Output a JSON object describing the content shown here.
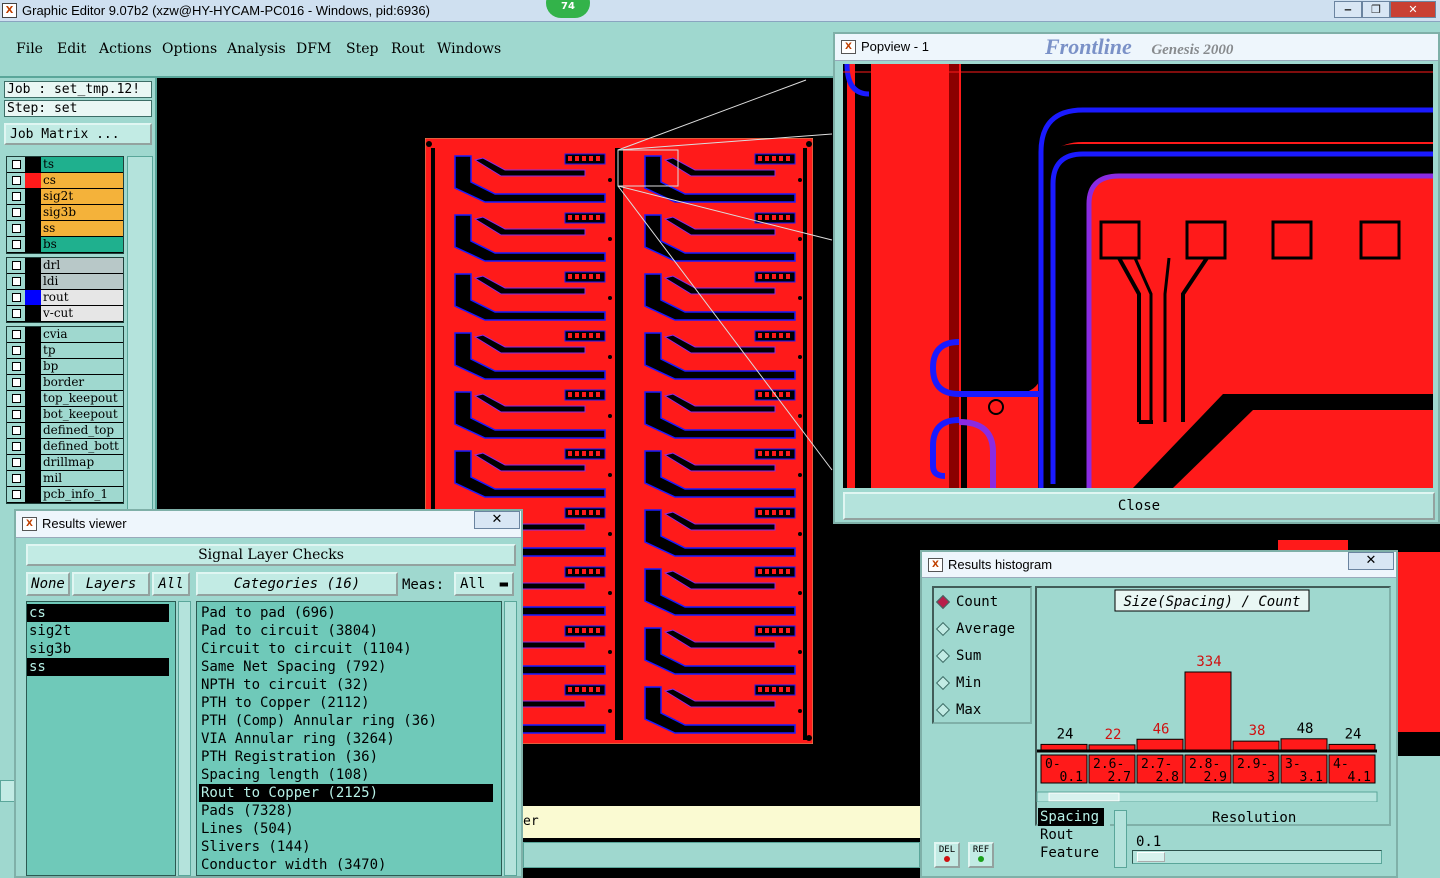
{
  "window": {
    "title": "Graphic Editor 9.07b2 (xzw@HY-HYCAM-PC016 - Windows, pid:6936)",
    "taskbar_badge": "74",
    "min_label": "‒",
    "max_label": "❐",
    "close_label": "✕"
  },
  "menu": [
    "File",
    "Edit",
    "Actions",
    "Options",
    "Analysis",
    "DFM",
    "Step",
    "Rout",
    "Windows"
  ],
  "info": {
    "job": "Job : set_tmp.12!",
    "step": "Step: set",
    "job_matrix": "Job Matrix ..."
  },
  "layer_groups": [
    [
      {
        "name": "ts",
        "color": "#1fb08e"
      },
      {
        "name": "cs",
        "color": "#f4b23a",
        "swatch": "#ff1a1a"
      },
      {
        "name": "sig2t",
        "color": "#f4b23a"
      },
      {
        "name": "sig3b",
        "color": "#f4b23a"
      },
      {
        "name": "ss",
        "color": "#f4b23a"
      },
      {
        "name": "bs",
        "color": "#1fb08e"
      }
    ],
    [
      {
        "name": "drl",
        "color": "#b8c8c8"
      },
      {
        "name": "ldi",
        "color": "#b8c8c8"
      },
      {
        "name": "rout",
        "color": "#e6e6e6",
        "swatch": "#0000ff"
      },
      {
        "name": "v-cut",
        "color": "#e6e6e6"
      }
    ],
    [
      {
        "name": "cvia",
        "color": "#9fd8cf"
      },
      {
        "name": "tp",
        "color": "#9fd8cf"
      },
      {
        "name": "bp",
        "color": "#9fd8cf"
      },
      {
        "name": "border",
        "color": "#9fd8cf"
      },
      {
        "name": "top_keepout",
        "color": "#9fd8cf"
      },
      {
        "name": "bot_keepout",
        "color": "#9fd8cf"
      },
      {
        "name": "defined_top",
        "color": "#9fd8cf"
      },
      {
        "name": "defined_bott",
        "color": "#9fd8cf"
      },
      {
        "name": "drillmap",
        "color": "#9fd8cf"
      },
      {
        "name": "mil",
        "color": "#9fd8cf"
      },
      {
        "name": "pcb_info_1",
        "color": "#9fd8cf"
      }
    ]
  ],
  "popview": {
    "title": "Popview - 1",
    "banner_brand": "Frontline",
    "banner_product": "Genesis 2000",
    "close": "Close"
  },
  "results_viewer": {
    "title": "Results viewer",
    "heading": "Signal Layer Checks",
    "none_btn": "None",
    "layers_btn": "Layers",
    "all_btn": "All",
    "categories_btn": "Categories (16)",
    "meas_label": "Meas:",
    "meas_value": "All",
    "layers": [
      {
        "name": "cs",
        "selected": true
      },
      {
        "name": "sig2t",
        "selected": false
      },
      {
        "name": "sig3b",
        "selected": false
      },
      {
        "name": "ss",
        "selected": true
      }
    ],
    "categories": [
      {
        "label": "Pad to pad (696)",
        "selected": false
      },
      {
        "label": "Pad to circuit (3804)",
        "selected": false
      },
      {
        "label": "Circuit to circuit (1104)",
        "selected": false
      },
      {
        "label": "Same Net Spacing (792)",
        "selected": false
      },
      {
        "label": "NPTH to circuit (32)",
        "selected": false
      },
      {
        "label": "PTH to Copper (2112)",
        "selected": false
      },
      {
        "label": "PTH (Comp) Annular ring (36)",
        "selected": false
      },
      {
        "label": "VIA Annular ring (3264)",
        "selected": false
      },
      {
        "label": "PTH Registration (36)",
        "selected": false
      },
      {
        "label": "Spacing length (108)",
        "selected": false
      },
      {
        "label": "Rout to Copper (2125)",
        "selected": true
      },
      {
        "label": "Pads (7328)",
        "selected": false
      },
      {
        "label": "Lines (504)",
        "selected": false
      },
      {
        "label": "Slivers (144)",
        "selected": false
      },
      {
        "label": "Conductor width (3470)",
        "selected": false
      }
    ]
  },
  "histogram": {
    "title": "Results histogram",
    "modes": [
      {
        "label": "Count",
        "on": true
      },
      {
        "label": "Average",
        "on": false
      },
      {
        "label": "Sum",
        "on": false
      },
      {
        "label": "Min",
        "on": false
      },
      {
        "label": "Max",
        "on": false
      }
    ],
    "bottom_list": [
      {
        "label": "Spacing",
        "selected": true
      },
      {
        "label": "Rout",
        "selected": false
      },
      {
        "label": "Feature",
        "selected": false
      }
    ],
    "resolution_label": "Resolution",
    "resolution_value": "0.1",
    "del_label": "DEL",
    "ref_label": "REF"
  },
  "chart_data": {
    "type": "bar",
    "title": "Size(Spacing) / Count",
    "categories": [
      "0-\n0.1",
      "2.6-\n2.7",
      "2.7-\n2.8",
      "2.8-\n2.9",
      "2.9-\n3",
      "3-\n3.1",
      "4-\n4.1"
    ],
    "category_labels": [
      [
        "0-",
        "0.1"
      ],
      [
        "2.6-",
        "2.7"
      ],
      [
        "2.7-",
        "2.8"
      ],
      [
        "2.8-",
        "2.9"
      ],
      [
        "2.9-",
        "3"
      ],
      [
        "3-",
        "3.1"
      ],
      [
        "4-",
        "4.1"
      ]
    ],
    "values": [
      24,
      22,
      46,
      334,
      38,
      48,
      24
    ],
    "label_colors": [
      "#000000",
      "#d01010",
      "#d01010",
      "#d01010",
      "#d01010",
      "#000000",
      "#000000"
    ],
    "bar_color": "#ff1a1a",
    "ylim": [
      0,
      334
    ]
  },
  "colors": {
    "panel": "#9fd8cf",
    "copper": "#ff1a1a",
    "rout": "#1a1aff",
    "trace_outline": "#8a2be2"
  }
}
